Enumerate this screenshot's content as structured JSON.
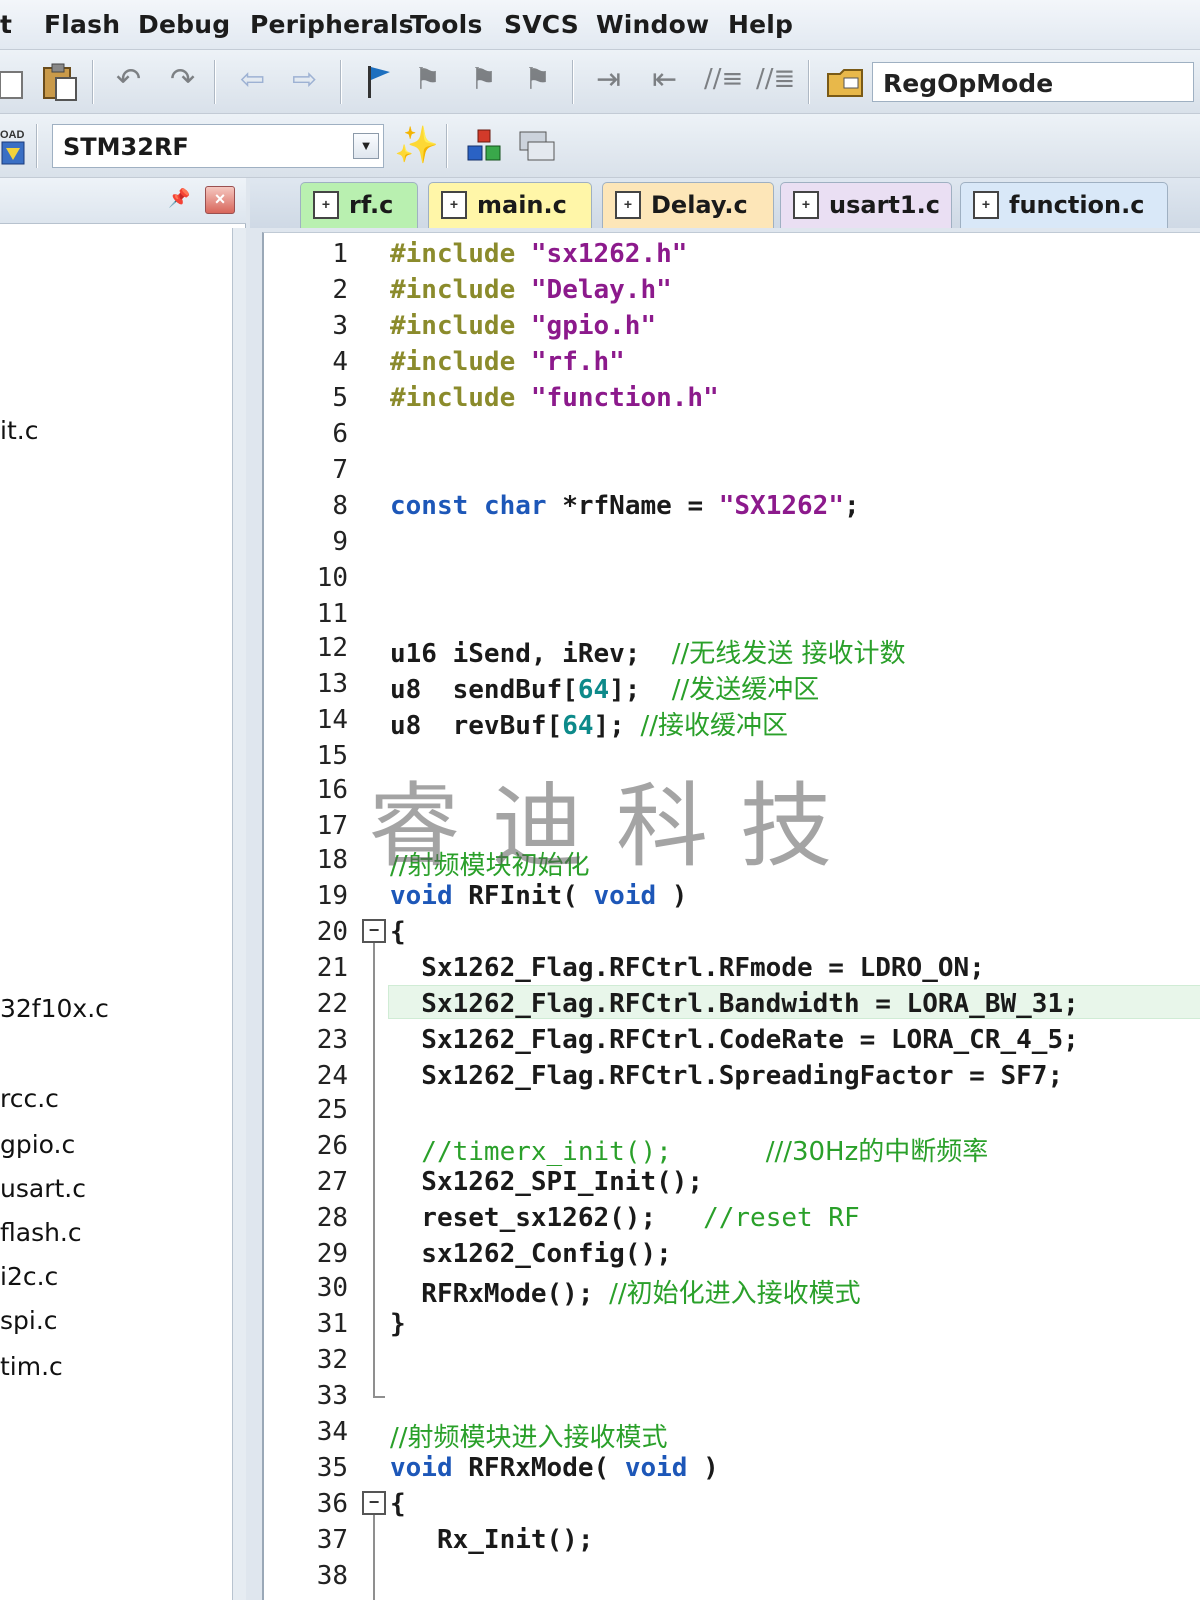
{
  "menubar": {
    "items": [
      "t",
      "Flash",
      "Debug",
      "Peripherals",
      "Tools",
      "SVCS",
      "Window",
      "Help"
    ]
  },
  "toolbar": {
    "find_value": "RegOpMode",
    "target_value": "STM32RF",
    "load_label": "OAD"
  },
  "project_panel": {
    "pin_icon": "pin-icon",
    "close_label": "×",
    "items": [
      "it.c",
      "32f10x.c",
      "rcc.c",
      "gpio.c",
      "usart.c",
      "flash.c",
      "i2c.c",
      "spi.c",
      "tim.c"
    ]
  },
  "tabs": [
    {
      "label": "rf.c",
      "active": true,
      "color": "#b9f0b0"
    },
    {
      "label": "main.c",
      "active": false,
      "color": "#fff6a8"
    },
    {
      "label": "Delay.c",
      "active": false,
      "color": "#fde6b8"
    },
    {
      "label": "usart1.c",
      "active": false,
      "color": "#eadff3"
    },
    {
      "label": "function.c",
      "active": false,
      "color": "#d9e8f8"
    }
  ],
  "editor": {
    "line_numbers": [
      "1",
      "2",
      "3",
      "4",
      "5",
      "6",
      "7",
      "8",
      "9",
      "10",
      "11",
      "12",
      "13",
      "14",
      "15",
      "16",
      "17",
      "18",
      "19",
      "20",
      "21",
      "22",
      "23",
      "24",
      "25",
      "26",
      "27",
      "28",
      "29",
      "30",
      "31",
      "32",
      "33",
      "34",
      "35",
      "36",
      "37",
      "38"
    ],
    "code": {
      "l1_kw": "#include",
      "l1_str": "\"sx1262.h\"",
      "l2_kw": "#include",
      "l2_str": "\"Delay.h\"",
      "l3_kw": "#include",
      "l3_str": "\"gpio.h\"",
      "l4_kw": "#include",
      "l4_str": "\"rf.h\"",
      "l5_kw": "#include",
      "l5_str": "\"function.h\"",
      "l8_kw1": "const",
      "l8_kw2": "char",
      "l8_rest": " *rfName = ",
      "l8_str": "\"SX1262\"",
      "l8_end": ";",
      "l12_code": "u16 iSend, iRev;  ",
      "l12_cm": "//无线发送 接收计数",
      "l13_a": "u8  sendBuf[",
      "l13_num": "64",
      "l13_b": "];  ",
      "l13_cm": "//发送缓冲区",
      "l14_a": "u8  revBuf[",
      "l14_num": "64",
      "l14_b": "]; ",
      "l14_cm": "//接收缓冲区",
      "l18_cm": "//射频模块初始化",
      "l19_kw": "void",
      "l19_mid": " RFInit( ",
      "l19_kw2": "void",
      "l19_end": " )",
      "l20": "{",
      "l21": "  Sx1262_Flag.RFCtrl.RFmode = LDRO_ON;",
      "l22": "  Sx1262_Flag.RFCtrl.Bandwidth = LORA_BW_31;",
      "l23": "  Sx1262_Flag.RFCtrl.CodeRate = LORA_CR_4_5;",
      "l24": "  Sx1262_Flag.RFCtrl.SpreadingFactor = SF7;",
      "l26_cm1": "  //timerx_init();",
      "l26_cm2": "///30Hz的中断频率",
      "l27": "  Sx1262_SPI_Init();",
      "l28": "  reset_sx1262();   ",
      "l28_cm": "//reset RF",
      "l29": "  sx1262_Config();",
      "l30": "  RFRxMode(); ",
      "l30_cm": "//初始化进入接收模式",
      "l31": "}",
      "l34_cm": "//射频模块进入接收模式",
      "l35_kw": "void",
      "l35_mid": " RFRxMode( ",
      "l35_kw2": "void",
      "l35_end": " )",
      "l36": "{",
      "l37": "   Rx_Init();"
    },
    "watermark": "睿迪科技"
  },
  "colors": {
    "preprocessor": "#8b8b2c",
    "string": "#8c1a8c",
    "keyword": "#1d57b8",
    "comment": "#2aa02a",
    "number": "#0d8a8a",
    "current_line": "#e8f6ea"
  }
}
